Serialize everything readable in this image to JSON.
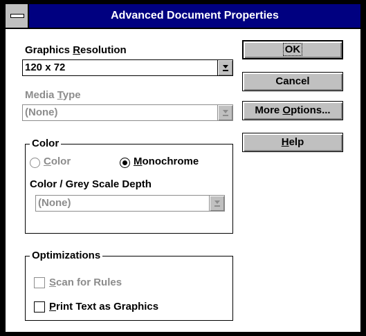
{
  "window": {
    "title": "Advanced Document Properties"
  },
  "graphics_resolution": {
    "label_pre": "Graphics ",
    "label_ul": "R",
    "label_post": "esolution",
    "value": "120 x 72"
  },
  "media_type": {
    "label_pre": "Media ",
    "label_ul": "T",
    "label_post": "ype",
    "value": "(None)"
  },
  "color_group": {
    "legend": "Color",
    "color_option": {
      "label_ul": "C",
      "label_post": "olor",
      "selected": false
    },
    "monochrome_option": {
      "label_ul": "M",
      "label_post": "onochrome",
      "selected": true
    },
    "depth_label": "Color / Grey Scale Depth",
    "depth_value": "(None)"
  },
  "optimizations_group": {
    "legend": "Optimizations",
    "scan_for_rules": {
      "label_ul": "S",
      "label_post": "can for Rules",
      "checked": false
    },
    "print_text_as_graphics": {
      "label_ul": "P",
      "label_post": "rint Text as Graphics",
      "checked": false
    }
  },
  "buttons": {
    "ok": "OK",
    "cancel": "Cancel",
    "more_options_pre": "More ",
    "more_options_ul": "O",
    "more_options_post": "ptions...",
    "help_ul": "H",
    "help_post": "elp"
  },
  "colors": {
    "titlebar": "#000080",
    "button_face": "#c0c0c0",
    "disabled_text": "#8c8c8c"
  },
  "icons": [
    "system-menu-icon",
    "dropdown-arrow-icon"
  ]
}
